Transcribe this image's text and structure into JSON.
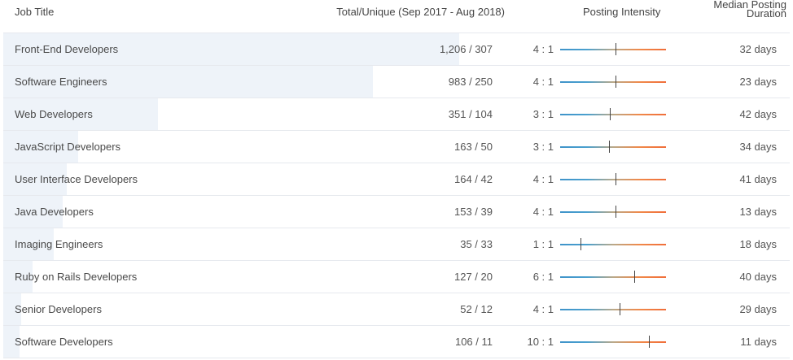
{
  "headers": {
    "job_title": "Job Title",
    "total_unique": "Total/Unique (Sep 2017 - Aug 2018)",
    "posting_intensity": "Posting Intensity",
    "median_line1": "Median Posting",
    "median_line2": "Duration"
  },
  "colors": {
    "intensity_start": "#3f93c9",
    "intensity_end": "#f06e3a",
    "row_bar": "#eef3f9"
  },
  "rows": [
    {
      "title": "Front-End Developers",
      "total": "1,206 / 307",
      "ratio": "4 : 1",
      "duration": "32 days",
      "bar_fraction": 1.0,
      "intensity_level": 0.52
    },
    {
      "title": "Software Engineers",
      "total": "983 / 250",
      "ratio": "4 : 1",
      "duration": "23 days",
      "bar_fraction": 0.81,
      "intensity_level": 0.52
    },
    {
      "title": "Web Developers",
      "total": "351 / 104",
      "ratio": "3 : 1",
      "duration": "42 days",
      "bar_fraction": 0.34,
      "intensity_level": 0.47
    },
    {
      "title": "JavaScript Developers",
      "total": "163 / 50",
      "ratio": "3 : 1",
      "duration": "34 days",
      "bar_fraction": 0.165,
      "intensity_level": 0.46
    },
    {
      "title": "User Interface Developers",
      "total": "164 / 42",
      "ratio": "4 : 1",
      "duration": "41 days",
      "bar_fraction": 0.14,
      "intensity_level": 0.52
    },
    {
      "title": "Java Developers",
      "total": "153 / 39",
      "ratio": "4 : 1",
      "duration": "13 days",
      "bar_fraction": 0.13,
      "intensity_level": 0.52
    },
    {
      "title": "Imaging Engineers",
      "total": "35 / 33",
      "ratio": "1 : 1",
      "duration": "18 days",
      "bar_fraction": 0.11,
      "intensity_level": 0.19
    },
    {
      "title": "Ruby on Rails Developers",
      "total": "127 / 20",
      "ratio": "6 : 1",
      "duration": "40 days",
      "bar_fraction": 0.065,
      "intensity_level": 0.7
    },
    {
      "title": "Senior Developers",
      "total": "52 / 12",
      "ratio": "4 : 1",
      "duration": "29 days",
      "bar_fraction": 0.04,
      "intensity_level": 0.56
    },
    {
      "title": "Software Developers",
      "total": "106 / 11",
      "ratio": "10 : 1",
      "duration": "11 days",
      "bar_fraction": 0.036,
      "intensity_level": 0.84
    }
  ]
}
